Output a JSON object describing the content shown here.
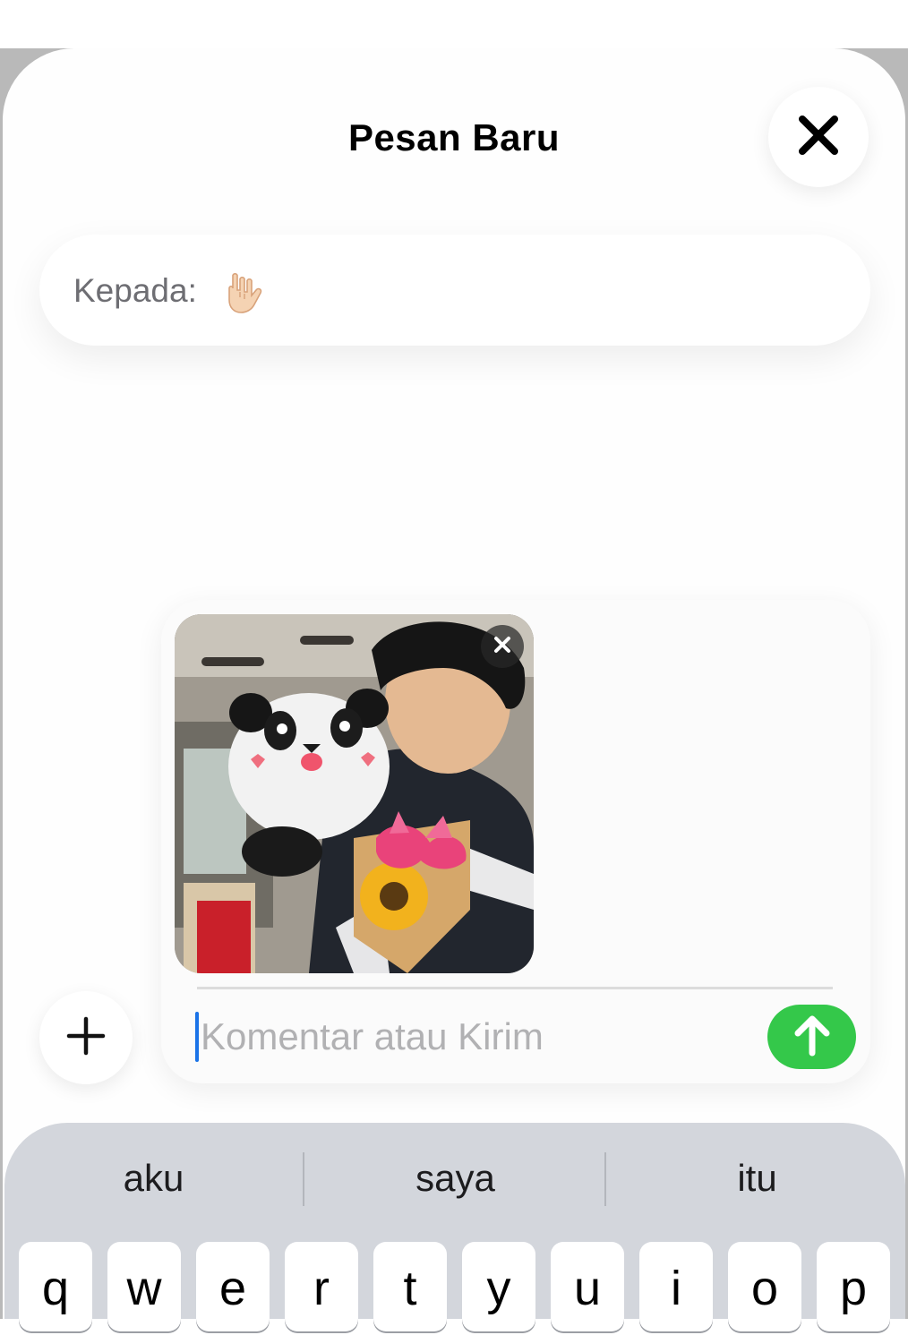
{
  "header": {
    "title": "Pesan Baru"
  },
  "recipient": {
    "label": "Kepada:"
  },
  "composer": {
    "placeholder": "Komentar atau Kirim",
    "value": ""
  },
  "keyboard": {
    "suggestions": [
      "aku",
      "saya",
      "itu"
    ],
    "row1": [
      "q",
      "w",
      "e",
      "r",
      "t",
      "y",
      "u",
      "i",
      "o",
      "p"
    ]
  },
  "colors": {
    "send_button": "#34c84a",
    "cursor": "#1a73e8",
    "keyboard_bg": "#d3d6dc"
  },
  "icons": {
    "close": "close-icon",
    "attach": "plus-icon",
    "send": "arrow-up-icon",
    "remove_attachment": "close-icon",
    "recipient_emoji": "love-you-gesture-emoji"
  }
}
